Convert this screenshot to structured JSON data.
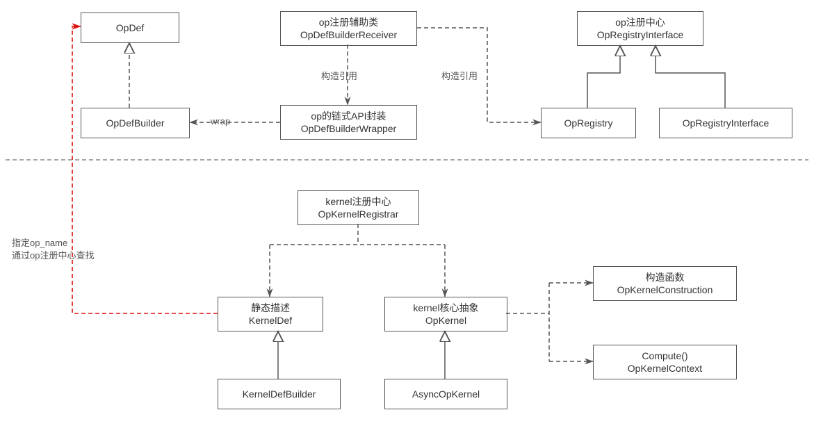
{
  "nodes": {
    "opdef": {
      "l1": "OpDef"
    },
    "opdefbuilder": {
      "l1": "OpDefBuilder"
    },
    "receiver": {
      "l1": "op注册辅助类",
      "l2": "OpDefBuilderReceiver"
    },
    "wrapper": {
      "l1": "op的链式API封装",
      "l2": "OpDefBuilderWrapper"
    },
    "registrycenter": {
      "l1": "op注册中心",
      "l2": "OpRegistryInterface"
    },
    "opregistry": {
      "l1": "OpRegistry"
    },
    "opregistryif": {
      "l1": "OpRegistryInterface"
    },
    "kreg": {
      "l1": "kernel注册中心",
      "l2": "OpKernelRegistrar"
    },
    "kdef": {
      "l1": "静态描述",
      "l2": "KernelDef"
    },
    "opkernel": {
      "l1": "kernel核心抽象",
      "l2": "OpKernel"
    },
    "cons": {
      "l1": "构造函数",
      "l2": "OpKernelConstruction"
    },
    "ctx": {
      "l1": "Compute()",
      "l2": "OpKernelContext"
    },
    "kdefb": {
      "l1": "KernelDefBuilder"
    },
    "asynck": {
      "l1": "AsyncOpKernel"
    }
  },
  "labels": {
    "wrap": "wrap",
    "gref1": "构造引用",
    "gref2": "构造引用",
    "note1": "指定op_name",
    "note2": "通过op注册中心查找"
  }
}
